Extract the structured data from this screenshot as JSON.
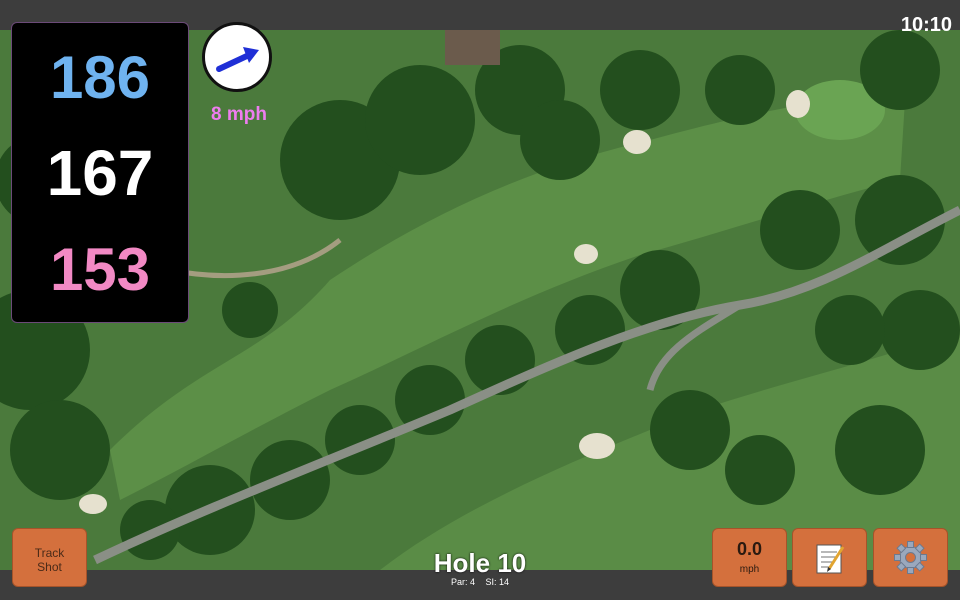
{
  "status_bar": {
    "time": "10:10"
  },
  "distances": {
    "back": "186",
    "middle": "167",
    "front": "153"
  },
  "wind": {
    "speed_label": "8 mph",
    "direction_icon": "wind-arrow-icon"
  },
  "hole": {
    "title": "Hole 10",
    "par_label": "Par: 4",
    "si_label": "SI: 14"
  },
  "buttons": {
    "track_shot": "Track Shot",
    "wind_value": "0.0",
    "wind_unit": "mph",
    "notes_icon": "notepad-icon",
    "settings_icon": "gear-icon"
  },
  "colors": {
    "back_distance": "#6fb3f0",
    "middle_distance": "#ffffff",
    "front_distance": "#f289c4",
    "wind_text": "#ee7df0",
    "button_bg": "#d4703d"
  }
}
